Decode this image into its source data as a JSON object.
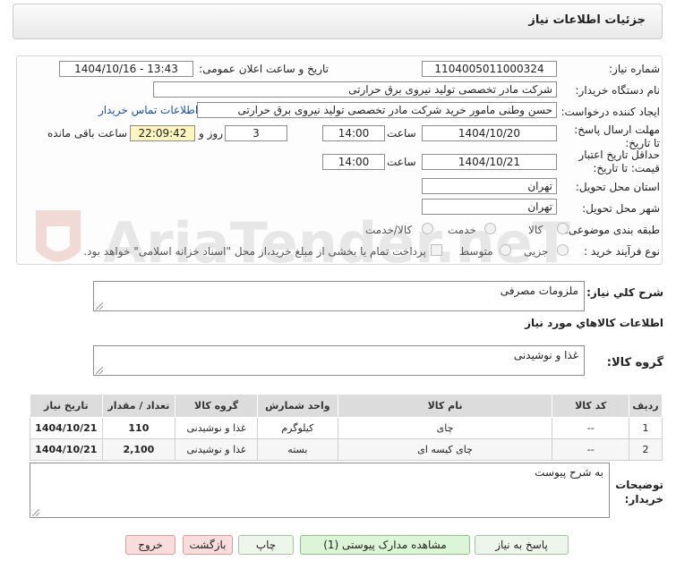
{
  "page": {
    "title": "جزئیات اطلاعات نیاز"
  },
  "form": {
    "need_number": {
      "label": "شماره نیاز:",
      "value": "1104005011000324"
    },
    "announce_datetime": {
      "label": "تاریخ و ساعت اعلان عمومی:",
      "value": "1404/10/16 - 13:43"
    },
    "buyer_org": {
      "label": "نام دستگاه خریدار:",
      "value": "شرکت مادر تخصصی تولید نیروی برق حرارتی"
    },
    "requester": {
      "label": "ایجاد کننده درخواست:",
      "value": "حسن وطنی مامور خرید شرکت مادر تخصصی تولید نیروی برق حرارتی"
    },
    "buyer_contact_link": "اطلاعات تماس خریدار",
    "reply_deadline": {
      "label": "مهلت ارسال پاسخ: تا تاریخ:",
      "date": "1404/10/20",
      "time_label": "ساعت",
      "time": "14:00",
      "days": "3",
      "days_label": "روز و",
      "remaining": "22:09:42",
      "remaining_label": "ساعت باقی مانده"
    },
    "price_validity": {
      "label": "حداقل تاریخ اعتبار قیمت: تا تاریخ:",
      "date": "1404/10/21",
      "time_label": "ساعت",
      "time": "14:00"
    },
    "province": {
      "label": "استان محل تحویل:",
      "value": "تهران"
    },
    "city": {
      "label": "شهر محل تحویل:",
      "value": "تهران"
    },
    "category": {
      "label": "طبقه بندی موضوعی:",
      "options": [
        "کالا",
        "خدمت",
        "کالا/خدمت"
      ]
    },
    "process_type": {
      "label": "نوع فرآیند خرید :",
      "options": [
        "جزیی",
        "متوسط"
      ],
      "note": "پرداخت تمام یا بخشی از مبلغ خرید،از محل \"اسناد خزانه اسلامی\" خواهد بود."
    }
  },
  "description": {
    "label": "شرح کلي نياز:",
    "value": "ملزومات مصرفی"
  },
  "goods_info_heading": "اطلاعات کالاهاي مورد نياز",
  "goods_group": {
    "label": "گروه کالا:",
    "value": "غذا و نوشیدنی"
  },
  "table": {
    "headers": [
      "ردیف",
      "کد کالا",
      "نام کالا",
      "واحد شمارش",
      "گروه کالا",
      "تعداد / مقدار",
      "تاریخ نیاز"
    ],
    "rows": [
      [
        "1",
        "--",
        "چای",
        "کیلوگرم",
        "غذا و نوشیدنی",
        "110",
        "1404/10/21"
      ],
      [
        "2",
        "--",
        "چای کیسه ای",
        "بسته",
        "غذا و نوشیدنی",
        "2,100",
        "1404/10/21"
      ]
    ]
  },
  "buyer_notes": {
    "label": "توضیحات خریدار:",
    "value": "به شرح پیوست"
  },
  "buttons": {
    "reply": "پاسخ به نیاز",
    "attachments": "مشاهده مدارک پیوستی (1)",
    "print": "چاپ",
    "back": "بازگشت",
    "exit": "خروج"
  },
  "watermark_text": "AriaTender.neT"
}
